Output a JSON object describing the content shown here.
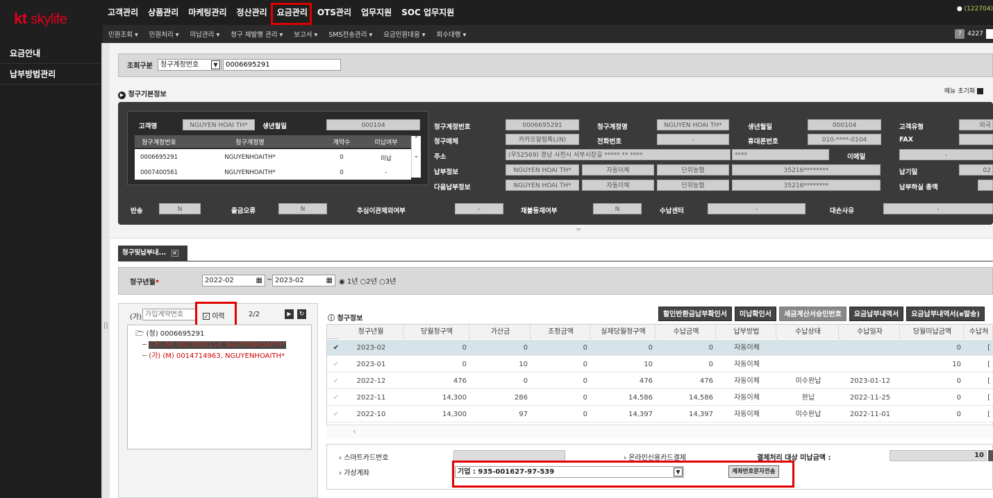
{
  "logo": {
    "brand": "kt",
    "product": "skylife"
  },
  "main_menu": [
    "고객관리",
    "상품관리",
    "마케팅관리",
    "정산관리",
    "요금관리",
    "OTS관리",
    "업무지원",
    "SOC 업무지원"
  ],
  "sub_menu": [
    "민원조회 ▾",
    "민원처리 ▾",
    "미납관리 ▾",
    "청구 재발행 관리 ▾",
    "보고서 ▾",
    "SMS전송관리 ▾",
    "요금민원대응 ▾",
    "회수대행 ▾"
  ],
  "user": {
    "id": "(122704)",
    "count": "4227"
  },
  "sidebar": [
    "요금안내",
    "납부방법관리"
  ],
  "search": {
    "label": "조회구분",
    "type": "청구계정번호",
    "value": "0006695291"
  },
  "basic_info": {
    "title": "청구기본정보",
    "menu_reset": "메뉴 초기화",
    "customer_label": "고객명",
    "customer": "NGUYEN HOAI TH*",
    "birth_label": "생년월일",
    "birth": "000104",
    "table_headers": [
      "청구계정번호",
      "청구계정명",
      "계약수",
      "미납여부"
    ],
    "table_rows": [
      [
        "0006695291",
        "NGUYENHOAITH*",
        "0",
        "미납"
      ],
      [
        "0007400561",
        "NGUYENHOAITH*",
        "0",
        "-"
      ]
    ],
    "acct_no_label": "청구계정번호",
    "acct_no": "0006695291",
    "acct_name_label": "청구계정명",
    "acct_name": "NGUYEN HOAI TH*",
    "birth2_label": "생년월일",
    "birth2": "000104",
    "cust_type_label": "고객유형",
    "cust_type": "외국",
    "medium_label": "청구매체",
    "medium": "카카오알림톡L(N)",
    "phone_label": "전화번호",
    "phone": "-",
    "mobile_label": "휴대폰번호",
    "mobile": "010-****-0104",
    "fax_label": "FAX",
    "fax": "",
    "addr_label": "주소",
    "addr": "(우52569) 경남 사천시 서부시장길 ***** ** ****",
    "addr2": "****",
    "email_label": "이메일",
    "email": "-",
    "pay_label": "납부정보",
    "pay": [
      "NGUYEN HOAI TH*",
      "자동이체",
      "단위농협",
      "35216********"
    ],
    "due_label": "납기일",
    "due": "02",
    "next_label": "다음납부정보",
    "next": [
      "NGUYEN HOAI TH*",
      "자동이체",
      "단위농협",
      "35216********"
    ],
    "unpaid_total_label": "납부하실 총액",
    "unpaid_total": "",
    "return_label": "반송",
    "return": "N",
    "withdraw_err_label": "출금오류",
    "withdraw_err": "N",
    "dormant_label": "추심이관제외여부",
    "dormant": "-",
    "bad_label": "채불등재여부",
    "bad": "N",
    "center_label": "수납센터",
    "center": "-",
    "loss_label": "대손사유",
    "loss": "-"
  },
  "tab": {
    "label": "청구및납부내...",
    "close": "×"
  },
  "period": {
    "label": "청구년월",
    "required": "*",
    "from": "2022-02",
    "to": "2023-02",
    "sep": "~",
    "options": [
      "1년",
      "2년",
      "3년"
    ]
  },
  "tree": {
    "filter_label": "(가)",
    "filter_placeholder": "가입계약번호",
    "history_label": "이력",
    "page": "2/2",
    "root": "(청) 0006695291",
    "items": [
      "(가) (M) 0013820114, NGUYENHOAITH*",
      "(가) (M) 0014714963, NGUYENHOAITH*"
    ]
  },
  "grid": {
    "title": "청구정보",
    "buttons": [
      "할인반환금납부확인서",
      "미납확인서",
      "세금계산서승인번호",
      "요금납부내역서",
      "요금납부내역서(e발송)"
    ],
    "headers": [
      "청구년월",
      "당월청구액",
      "가산금",
      "조정금액",
      "실제당월청구액",
      "수납금액",
      "납부방법",
      "수납상태",
      "수납일자",
      "당월미납금액",
      "수납처"
    ],
    "rows": [
      [
        "2023-02",
        "0",
        "0",
        "0",
        "0",
        "0",
        "자동이체",
        "",
        "",
        "0",
        "["
      ],
      [
        "2023-01",
        "0",
        "10",
        "0",
        "10",
        "0",
        "자동이체",
        "",
        "",
        "10",
        "["
      ],
      [
        "2022-12",
        "476",
        "0",
        "0",
        "476",
        "476",
        "자동이체",
        "미수완납",
        "2023-01-12",
        "0",
        "["
      ],
      [
        "2022-11",
        "14,300",
        "286",
        "0",
        "14,586",
        "14,586",
        "자동이체",
        "완납",
        "2022-11-25",
        "0",
        "["
      ],
      [
        "2022-10",
        "14,300",
        "97",
        "0",
        "14,397",
        "14,397",
        "자동이체",
        "미수완납",
        "2022-11-01",
        "0",
        "["
      ]
    ]
  },
  "bottom": {
    "smartcard_label": "스마트카드번호",
    "online_label": "온라인신용카드결제",
    "pay_target_label": "결제처리 대상 미납금액 :",
    "pay_target": "10",
    "vaccount_label": "가상계좌",
    "vaccount": "기업 : 935-001627-97-539",
    "sms_button": "계좌번호문자전송"
  }
}
